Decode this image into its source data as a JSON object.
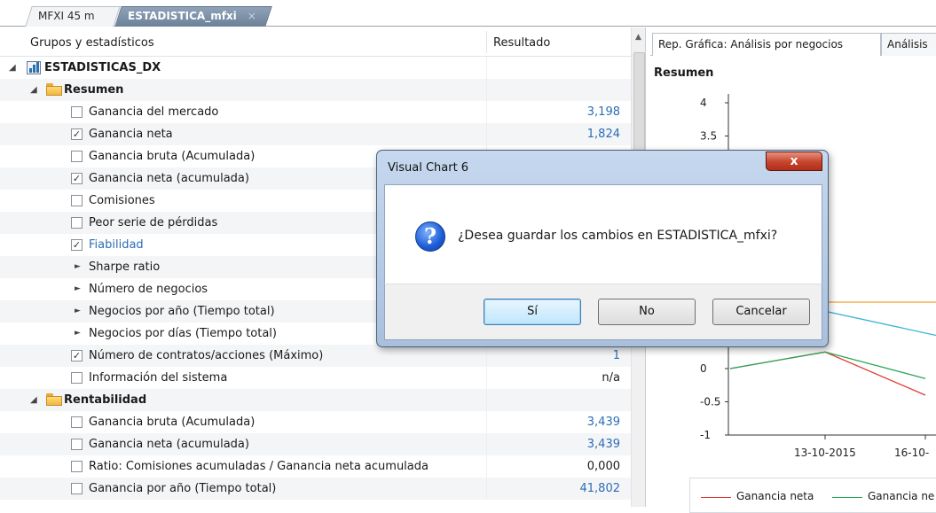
{
  "doc_tabs": [
    {
      "label": "MFXI 45 m"
    },
    {
      "label": "ESTADISTICA_mfxi",
      "close": "×"
    }
  ],
  "tree": {
    "header": {
      "col1": "Grupos y estadísticos",
      "col2": "Resultado"
    },
    "rows": [
      {
        "kind": "root",
        "label": "ESTADISTICAS_DX",
        "value": ""
      },
      {
        "kind": "group",
        "label": "Resumen",
        "value": ""
      },
      {
        "kind": "check",
        "checked": false,
        "label": "Ganancia del mercado",
        "value": "3,198",
        "vcolor": "blue"
      },
      {
        "kind": "check",
        "checked": true,
        "label": "Ganancia neta",
        "value": "1,824",
        "vcolor": "blue"
      },
      {
        "kind": "check",
        "checked": false,
        "label": "Ganancia bruta (Acumulada)",
        "value": "",
        "vcolor": "blue"
      },
      {
        "kind": "check",
        "checked": true,
        "label": "Ganancia neta (acumulada)",
        "value": "",
        "vcolor": "blue"
      },
      {
        "kind": "check",
        "checked": false,
        "label": "Comisiones",
        "value": "",
        "vcolor": "blue"
      },
      {
        "kind": "check",
        "checked": false,
        "label": "Peor serie de pérdidas",
        "value": "",
        "vcolor": "blue"
      },
      {
        "kind": "check",
        "checked": true,
        "label": "Fiabilidad",
        "value": "",
        "vcolor": "blue",
        "lcolor": "blue"
      },
      {
        "kind": "sub",
        "label": "Sharpe ratio",
        "value": ""
      },
      {
        "kind": "sub",
        "label": "Número de negocios",
        "value": ""
      },
      {
        "kind": "sub",
        "label": "Negocios por año (Tiempo total)",
        "value": ""
      },
      {
        "kind": "sub",
        "label": "Negocios por días (Tiempo total)",
        "value": ""
      },
      {
        "kind": "check",
        "checked": true,
        "label": "Número de contratos/acciones (Máximo)",
        "value": "1",
        "vcolor": "blue"
      },
      {
        "kind": "check",
        "checked": false,
        "label": "Información del sistema",
        "value": "n/a",
        "vcolor": "black"
      },
      {
        "kind": "group",
        "label": "Rentabilidad",
        "value": ""
      },
      {
        "kind": "check",
        "checked": false,
        "label": "Ganancia bruta (Acumulada)",
        "value": "3,439",
        "vcolor": "blue"
      },
      {
        "kind": "check",
        "checked": false,
        "label": "Ganancia neta (acumulada)",
        "value": "3,439",
        "vcolor": "blue"
      },
      {
        "kind": "check",
        "checked": false,
        "label": "Ratio: Comisiones acumuladas / Ganancia neta acumulada",
        "value": "0,000",
        "vcolor": "black"
      },
      {
        "kind": "check",
        "checked": false,
        "label": "Ganancia por año (Tiempo total)",
        "value": "41,802",
        "vcolor": "blue"
      }
    ]
  },
  "right_panel": {
    "tabs": [
      {
        "label": "Rep. Gráfica: Análisis por negocios"
      },
      {
        "label": "Análisis"
      }
    ],
    "chart_title": "Resumen"
  },
  "chart_data": {
    "type": "line",
    "title": "Resumen",
    "y_ticks": [
      "4",
      "3.5",
      "0",
      "-0.5",
      "-1"
    ],
    "x_ticks": [
      "13-10-2015",
      "16-10-"
    ],
    "ylim": [
      -1,
      4
    ],
    "legend": [
      {
        "name": "Ganancia neta",
        "color": "#e03a2f"
      },
      {
        "name": "Ganancia ne",
        "color": "#2aa65a"
      }
    ],
    "series": [
      {
        "name": "Ganancia neta",
        "color": "#e03a2f",
        "y": [
          0,
          0.25,
          -0.4
        ]
      },
      {
        "name": "Ganancia ne",
        "color": "#2aa65a",
        "y": [
          0,
          0.25,
          -0.15
        ]
      },
      {
        "color": "#3ab3d8",
        "y": [
          null,
          1.0,
          0.5
        ]
      },
      {
        "color": "#f0a030",
        "y": [
          null,
          1.0,
          1.0
        ]
      }
    ]
  },
  "dialog": {
    "title": "Visual Chart 6",
    "close": "x",
    "icon": "question-icon",
    "message": "¿Desea guardar los cambios en ESTADISTICA_mfxi?",
    "buttons": {
      "yes": "Sí",
      "no": "No",
      "cancel": "Cancelar"
    }
  }
}
